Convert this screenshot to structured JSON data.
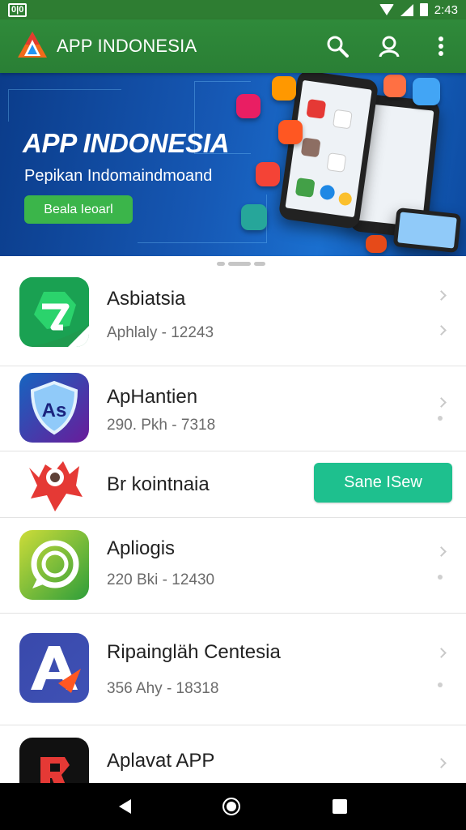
{
  "status_bar": {
    "left_badge": "0|0",
    "time": "2:43"
  },
  "app_bar": {
    "title": "APP INDONESIA",
    "icons": [
      "search-icon",
      "account-icon",
      "more-vert-icon"
    ]
  },
  "banner": {
    "title": "APP INDONESIA",
    "subtitle": "Pepikan Indomaindmoand",
    "button_label": "Beala Ieoarl"
  },
  "apps": [
    {
      "name": "Asbiatsia",
      "meta": "Aphlaly - 12243",
      "icon": "brand-green-shield-icon",
      "action": "chevron"
    },
    {
      "name": "ApHantien",
      "meta": "290. Pkh - 7318",
      "icon": "shield-as-icon",
      "action": "chevron"
    },
    {
      "name": "Br kointnaia",
      "meta": "",
      "icon": "red-monster-icon",
      "action": "button",
      "button_label": "Sane ISew"
    },
    {
      "name": "Apliogis",
      "meta": "220 Bki - 12430",
      "icon": "chat-bubble-icon",
      "action": "chevron"
    },
    {
      "name": "Ripaingläh Centesia",
      "meta": "356 Ahy - 18318",
      "icon": "letter-a-icon",
      "action": "chevron"
    },
    {
      "name": "Aplavat APP",
      "meta": "",
      "icon": "red-r-icon",
      "action": "chevron"
    }
  ],
  "colors": {
    "primary": "#2e7d32",
    "accent": "#1ec08e",
    "banner": "#1658b4"
  }
}
